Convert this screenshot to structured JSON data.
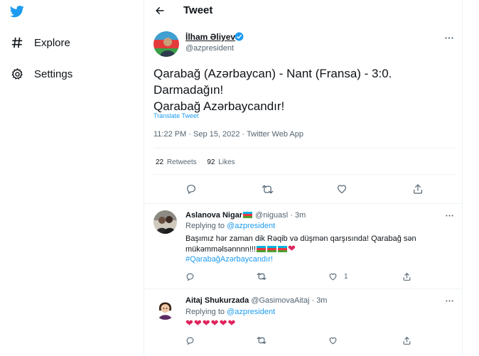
{
  "nav": {
    "items": [
      {
        "label": "Explore",
        "icon": "hashtag-icon"
      },
      {
        "label": "Settings",
        "icon": "gear-icon"
      }
    ]
  },
  "header": {
    "title": "Tweet"
  },
  "tweet": {
    "author_name": "İlham Əliyev",
    "author_handle": "@azpresident",
    "lines": [
      "Qarabağ (Azərbaycan) - Nant (Fransa) - 3:0.",
      "Darmadağın!",
      "Qarabağ Azərbaycandır!"
    ],
    "translate": "Translate Tweet",
    "meta": "11:22 PM · Sep 15, 2022 · Twitter Web App",
    "retweets_count": "22",
    "retweets_label": "Retweets",
    "likes_count": "92",
    "likes_label": "Likes"
  },
  "replies": [
    {
      "name": "Aslanova Nigar",
      "handle": "@niguasl",
      "time": "· 3m",
      "replying_prefix": "Replying to",
      "replying_to": "@azpresident",
      "text_line1": "Başımız hər zaman dik Rəqib və düşmən qarşısında! Qarabağ sən",
      "text_line2": "mükəmməlsənnnn!!!",
      "hashtag": "#QarabağAzərbaycandır!",
      "like_count": "1"
    },
    {
      "name": "Aitaj Shukurzada",
      "handle": "@GasimovaAitaj",
      "time": "· 3m",
      "replying_prefix": "Replying to",
      "replying_to": "@azpresident",
      "text": "❤❤❤❤❤❤"
    }
  ],
  "colors": {
    "accent": "#1d9bf0",
    "text": "#0f1419",
    "muted": "#536471",
    "border": "#eff3f4",
    "heart": "#e0245e"
  }
}
